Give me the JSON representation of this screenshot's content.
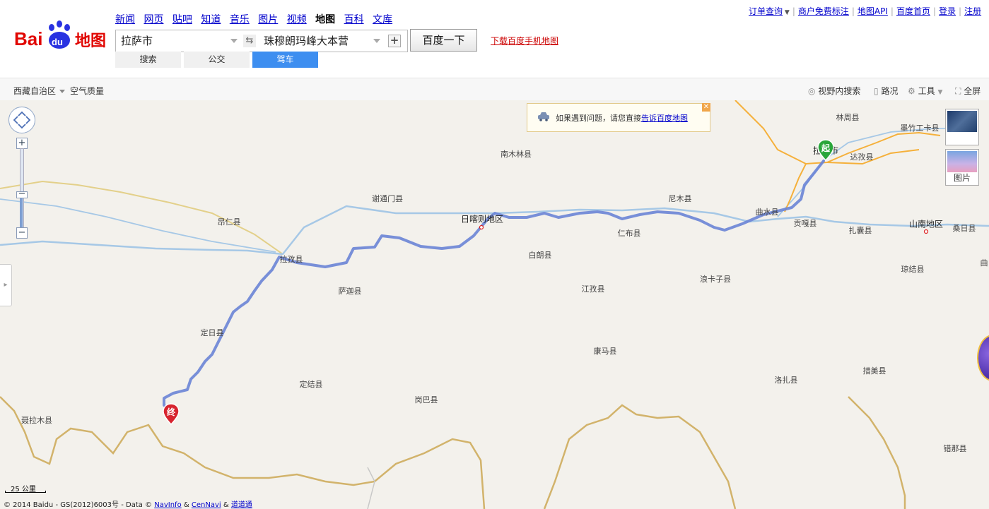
{
  "logo": {
    "bai": "Bai",
    "du": "du",
    "ditu": "地图"
  },
  "nav": [
    "新闻",
    "网页",
    "贴吧",
    "知道",
    "音乐",
    "图片",
    "视频",
    "地图",
    "百科",
    "文库"
  ],
  "nav_current": "地图",
  "search": {
    "origin": "拉萨市",
    "destination": "珠穆朗玛峰大本营",
    "swap_icon": "⇆",
    "add_icon": "+",
    "button": "百度一下"
  },
  "download_mobile": "下载百度手机地图",
  "mode_tabs": [
    "搜索",
    "公交",
    "驾车"
  ],
  "mode_active": "驾车",
  "top_links": {
    "orders": "订单查询",
    "merchant": "商户免费标注",
    "api": "地图API",
    "home": "百度首页",
    "login": "登录",
    "register": "注册"
  },
  "toolbar": {
    "region": "西藏自治区",
    "air_quality": "空气质量",
    "view_search": "视野内搜索",
    "traffic": "路况",
    "tools": "工具",
    "fullscreen": "全屏"
  },
  "notice": {
    "text": "如果遇到问题，请您直接",
    "link": "告诉百度地图",
    "close": "✕"
  },
  "map_types": {
    "satellite": "卫星",
    "image": "图片"
  },
  "markers": {
    "start": "起",
    "end": "终"
  },
  "scale_label": "25 公里",
  "copyright": {
    "text": "© 2014 Baidu - GS(2012)6003号 - Data ©",
    "navinfo": "NavInfo",
    "amp1": "&",
    "cennavi": "CenNavi",
    "amp2": "&",
    "daodaotong": "道道通"
  },
  "places": [
    {
      "name": "林周县"
    },
    {
      "name": "墨竹工卡县"
    },
    {
      "name": "拉萨市"
    },
    {
      "name": "达孜县"
    },
    {
      "name": "南木林县"
    },
    {
      "name": "谢通门县"
    },
    {
      "name": "尼木县"
    },
    {
      "name": "曲水县"
    },
    {
      "name": "昂仁县"
    },
    {
      "name": "日喀则地区"
    },
    {
      "name": "贡嘎县"
    },
    {
      "name": "扎囊县"
    },
    {
      "name": "山南地区"
    },
    {
      "name": "桑日县"
    },
    {
      "name": "仁布县"
    },
    {
      "name": "拉孜县"
    },
    {
      "name": "白朗县"
    },
    {
      "name": "琼结县"
    },
    {
      "name": "曲"
    },
    {
      "name": "萨迦县"
    },
    {
      "name": "浪卡子县"
    },
    {
      "name": "江孜县"
    },
    {
      "name": "定日县"
    },
    {
      "name": "康马县"
    },
    {
      "name": "措美县"
    },
    {
      "name": "定结县"
    },
    {
      "name": "洛扎县"
    },
    {
      "name": "岗巴县"
    },
    {
      "name": "聂拉木县"
    },
    {
      "name": "错那县"
    }
  ]
}
